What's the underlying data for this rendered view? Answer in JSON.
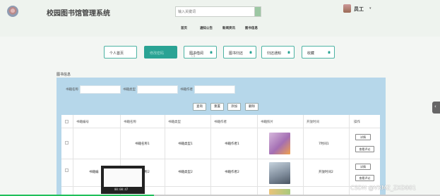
{
  "app": {
    "title": "校园图书馆管理系统",
    "search_placeholder": "输入关键词",
    "user_name": "员工",
    "user_caret": "▾"
  },
  "nav": [
    "首页",
    "通知公告",
    "新闻资讯",
    "图书信息"
  ],
  "tabs": [
    {
      "label": "个人首页",
      "active": false
    },
    {
      "label": "修改密码",
      "active": true
    },
    {
      "label": "图书借阅",
      "active": false
    },
    {
      "label": "图书归还",
      "active": false
    },
    {
      "label": "归还通知",
      "active": false
    },
    {
      "label": "收藏",
      "active": false
    }
  ],
  "section_title": "图书信息",
  "filters": {
    "labels": [
      "书籍名称",
      "书籍类型",
      "书籍作者"
    ]
  },
  "buttons": [
    "查询",
    "重置",
    "添加",
    "删除"
  ],
  "table": {
    "headers": [
      "书籍编号",
      "书籍名称",
      "书籍类型",
      "书籍作者",
      "书籍照片",
      "开放时间",
      "操作"
    ],
    "rows": [
      {
        "id": "",
        "name": "书籍名称1",
        "type": "书籍类型1",
        "author": "书籍作者1",
        "time": "7时间1",
        "actions": [
          "详情",
          "查看评论"
        ]
      },
      {
        "id": "书籍编",
        "name": "书籍名称2",
        "type": "书籍类型2",
        "author": "书籍作者2",
        "time": "开放时间2",
        "actions": [
          "详情",
          "查看评论"
        ]
      }
    ]
  },
  "video_popup": {
    "time": "00:00:47"
  },
  "video_progress": 0.35,
  "watermark": "CSDN @VXMZ_ZXD001",
  "colors": {
    "accent": "#2aa394",
    "panel": "#b6d7ea",
    "progress": "#1fbf5a"
  }
}
